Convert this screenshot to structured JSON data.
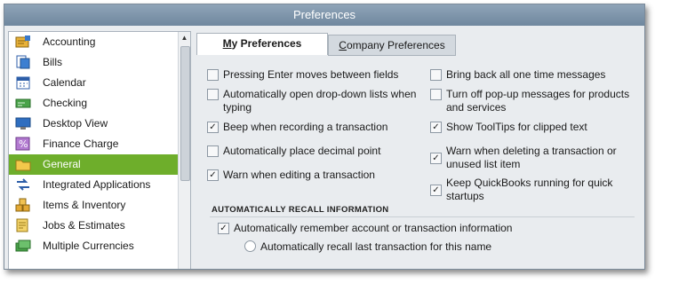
{
  "window": {
    "title": "Preferences"
  },
  "sidebar": {
    "items": [
      {
        "label": "Accounting",
        "icon": "accounting-icon",
        "selected": false
      },
      {
        "label": "Bills",
        "icon": "bills-icon",
        "selected": false
      },
      {
        "label": "Calendar",
        "icon": "calendar-icon",
        "selected": false
      },
      {
        "label": "Checking",
        "icon": "checking-icon",
        "selected": false
      },
      {
        "label": "Desktop View",
        "icon": "desktop-view-icon",
        "selected": false
      },
      {
        "label": "Finance Charge",
        "icon": "finance-charge-icon",
        "selected": false
      },
      {
        "label": "General",
        "icon": "general-folder-icon",
        "selected": true
      },
      {
        "label": "Integrated Applications",
        "icon": "integrated-applications-icon",
        "selected": false
      },
      {
        "label": "Items & Inventory",
        "icon": "items-inventory-icon",
        "selected": false
      },
      {
        "label": "Jobs & Estimates",
        "icon": "jobs-estimates-icon",
        "selected": false
      },
      {
        "label": "Multiple Currencies",
        "icon": "multiple-currencies-icon",
        "selected": false
      }
    ]
  },
  "tabs": {
    "my_prefix": "M",
    "my_rest": "y Preferences",
    "company_prefix": "C",
    "company_rest": "ompany Preferences"
  },
  "options": {
    "pressing_enter": {
      "label": "Pressing Enter moves between fields",
      "checked": false
    },
    "auto_open_dropdown": {
      "label": "Automatically open drop-down lists when typing",
      "checked": false
    },
    "beep": {
      "label": "Beep when recording a transaction",
      "checked": true
    },
    "decimal_point": {
      "label": "Automatically place decimal point",
      "checked": false
    },
    "warn_editing": {
      "label": "Warn when editing a transaction",
      "checked": true
    },
    "bring_back": {
      "label": "Bring back all one time messages",
      "checked": false
    },
    "turn_off_popups": {
      "label": "Turn off pop-up messages for products and services",
      "checked": false
    },
    "show_tooltips": {
      "label": "Show ToolTips for clipped text",
      "checked": true
    },
    "warn_deleting": {
      "label": "Warn when deleting a transaction or unused list item",
      "checked": true
    },
    "keep_running": {
      "label": "Keep QuickBooks running for quick startups",
      "checked": true
    }
  },
  "recall": {
    "section_title": "AUTOMATICALLY RECALL INFORMATION",
    "remember_label": "Automatically remember account or transaction information",
    "remember_checked": true,
    "radio_last_transaction": "Automatically recall last transaction for this name"
  },
  "colors": {
    "selected_item": "#6eae2b",
    "titlebar": "#7b93aa"
  }
}
